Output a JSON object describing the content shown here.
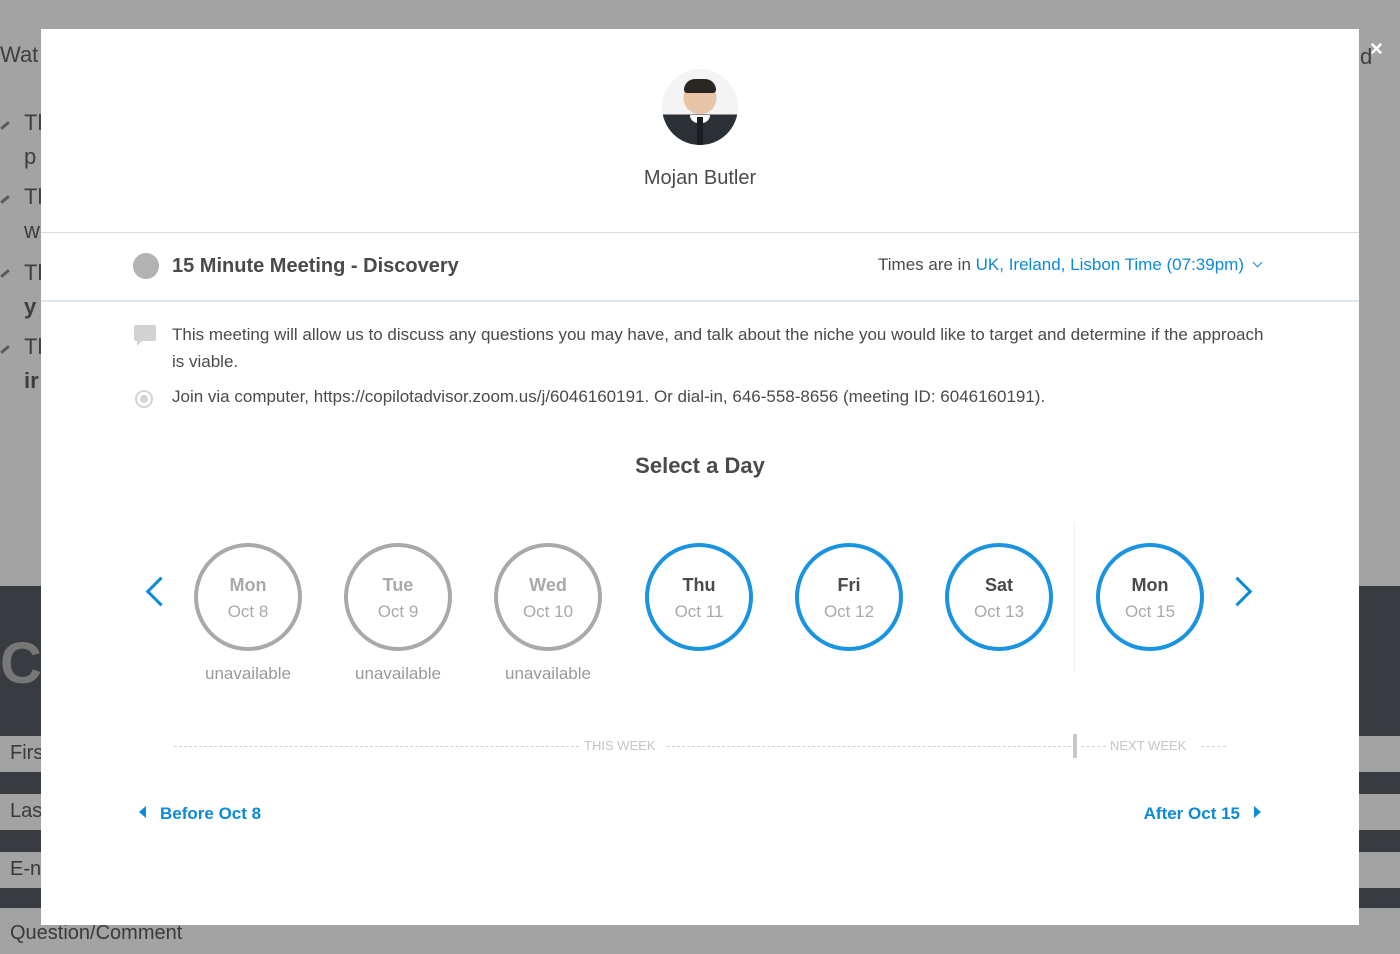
{
  "background": {
    "heading_fragment": "Wat",
    "heading_right_fragment": "d",
    "list_fragments": [
      "Tl",
      "p",
      "Tl",
      "w",
      "Tl",
      "y",
      "Tl",
      "ir"
    ],
    "section_fragment": "C",
    "form_fields": [
      "Firs",
      "Las",
      "E-n",
      "Question/Comment"
    ],
    "close_icon": "×"
  },
  "host": {
    "name": "Mojan Butler"
  },
  "event": {
    "title": "15 Minute Meeting - Discovery",
    "timezone_prefix": "Times are in",
    "timezone_value": "UK, Ireland, Lisbon Time (07:39pm)",
    "description": "This meeting will allow us to discuss any questions you may have, and talk about the niche you would like to target and determine if the approach is viable.",
    "location": "Join via computer, https://copilotadvisor.zoom.us/j/6046160191. Or dial-in, 646-558-8656 (meeting ID: 6046160191)."
  },
  "calendar": {
    "title": "Select a Day",
    "days": [
      {
        "name": "Mon",
        "date": "Oct 8",
        "available": false,
        "note": "unavailable"
      },
      {
        "name": "Tue",
        "date": "Oct 9",
        "available": false,
        "note": "unavailable"
      },
      {
        "name": "Wed",
        "date": "Oct 10",
        "available": false,
        "note": "unavailable"
      },
      {
        "name": "Thu",
        "date": "Oct 11",
        "available": true,
        "note": ""
      },
      {
        "name": "Fri",
        "date": "Oct 12",
        "available": true,
        "note": ""
      },
      {
        "name": "Sat",
        "date": "Oct 13",
        "available": true,
        "note": ""
      },
      {
        "name": "Mon",
        "date": "Oct 15",
        "available": true,
        "note": ""
      }
    ],
    "this_week_label": "THIS WEEK",
    "next_week_label": "NEXT WEEK",
    "before_label": "Before Oct 8",
    "after_label": "After Oct 15"
  },
  "colors": {
    "accent": "#0b8ad8",
    "unavailable": "#a9a9a9",
    "text": "#4a4a4a"
  }
}
